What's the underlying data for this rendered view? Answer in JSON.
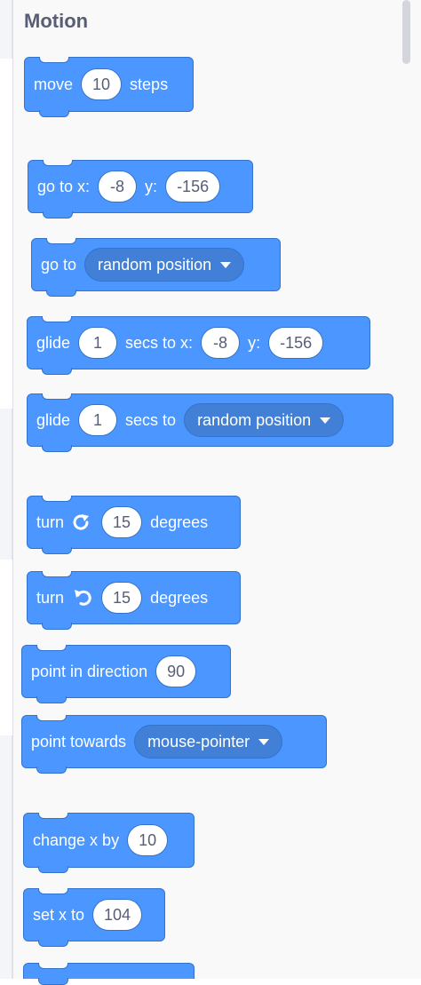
{
  "category": {
    "title": "Motion"
  },
  "colors": {
    "block": "#4c97ff",
    "block_border": "#3373cc",
    "dropdown": "#4280d7",
    "input_text": "#575e75",
    "title": "#575e75"
  },
  "blocks": {
    "move": {
      "label_a": "move",
      "value": "10",
      "label_b": "steps"
    },
    "go_to_xy": {
      "label_a": "go to x:",
      "x": "-8",
      "label_b": "y:",
      "y": "-156"
    },
    "go_to": {
      "label_a": "go to",
      "menu": "random position"
    },
    "glide_xy": {
      "label_a": "glide",
      "secs": "1",
      "label_b": "secs to x:",
      "x": "-8",
      "label_c": "y:",
      "y": "-156"
    },
    "glide_to": {
      "label_a": "glide",
      "secs": "1",
      "label_b": "secs to",
      "menu": "random position"
    },
    "turn_right": {
      "label_a": "turn",
      "icon": "rotate-clockwise-icon",
      "value": "15",
      "label_b": "degrees"
    },
    "turn_left": {
      "label_a": "turn",
      "icon": "rotate-counterclockwise-icon",
      "value": "15",
      "label_b": "degrees"
    },
    "point_direction": {
      "label_a": "point in direction",
      "value": "90"
    },
    "point_towards": {
      "label_a": "point towards",
      "menu": "mouse-pointer"
    },
    "change_x": {
      "label_a": "change x by",
      "value": "10"
    },
    "set_x": {
      "label_a": "set x to",
      "value": "104"
    }
  }
}
